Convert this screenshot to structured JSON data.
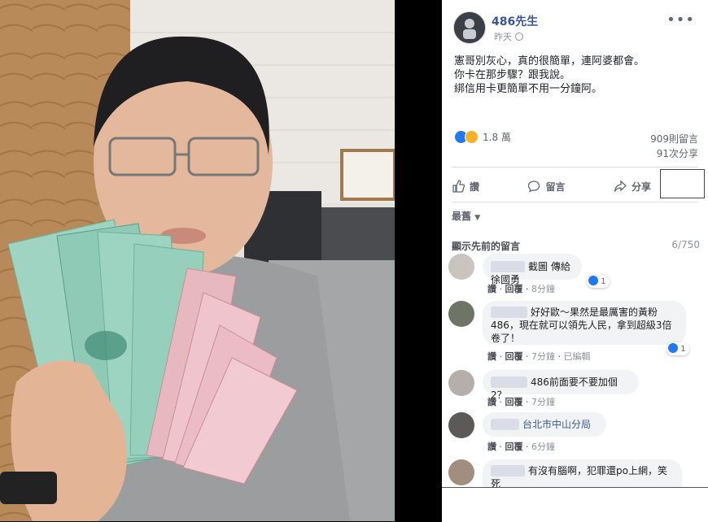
{
  "post": {
    "author": "486先生",
    "time": "昨天",
    "lines": [
      "憲哥別灰心，真的很簡單，連阿婆都會。",
      "你卡在那步驟？跟我說。",
      "綁信用卡更簡單不用一分鐘阿。"
    ],
    "reaction_count": "1.8 萬",
    "comment_count": "909則留言",
    "share_count": "91次分享"
  },
  "actions": {
    "like": "讚",
    "comment": "留言",
    "share": "分享"
  },
  "sort_label": "最舊",
  "previous": {
    "label": "顯示先前的留言",
    "count": "6/750"
  },
  "comments": [
    {
      "text": "截圖 傳給徐國勇",
      "like": "讚",
      "reply": "回覆",
      "time": "8分鐘",
      "edited": "",
      "likes": "1"
    },
    {
      "text": "好好歐～果然是最厲害的黃粉 486，現在就可以領先人民，拿到超級3倍卷了！",
      "like": "讚",
      "reply": "回覆",
      "time": "7分鐘",
      "edited": "已編輯",
      "likes": "1"
    },
    {
      "text": "486前面要不要加個2？",
      "like": "讚",
      "reply": "回覆",
      "time": "7分鐘",
      "edited": "",
      "likes": ""
    },
    {
      "text": "台北市中山分局",
      "like": "讚",
      "reply": "回覆",
      "time": "6分鐘",
      "edited": "",
      "likes": ""
    },
    {
      "text": "有沒有腦啊，犯罪還po上網，笑死",
      "like": "",
      "reply": "",
      "time": "",
      "edited": "",
      "likes": ""
    }
  ],
  "colors": {
    "link": "#385898",
    "like_blue": "#2078f4",
    "bubble": "#f2f3f5"
  }
}
